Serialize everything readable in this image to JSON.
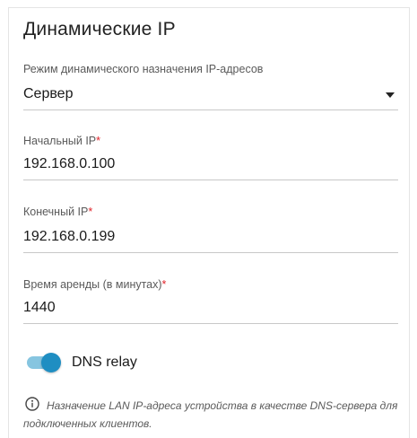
{
  "section": {
    "title": "Динамические IP"
  },
  "mode": {
    "label": "Режим динамического назначения IP-адресов",
    "value": "Сервер"
  },
  "start_ip": {
    "label": "Начальный IP",
    "required_mark": "*",
    "value": "192.168.0.100"
  },
  "end_ip": {
    "label": "Конечный IP",
    "required_mark": "*",
    "value": "192.168.0.199"
  },
  "lease_time": {
    "label": "Время аренды (в минутах)",
    "required_mark": "*",
    "value": "1440"
  },
  "dns_relay": {
    "label": "DNS relay",
    "enabled": true
  },
  "info": {
    "icon": "info-icon",
    "text": "Назначение LAN IP-адреса устройства в качестве DNS-сервера для подключенных клиентов."
  },
  "colors": {
    "toggle_knob": "#1f8ec2",
    "toggle_track": "#86c5e0",
    "required": "#e0232a"
  }
}
